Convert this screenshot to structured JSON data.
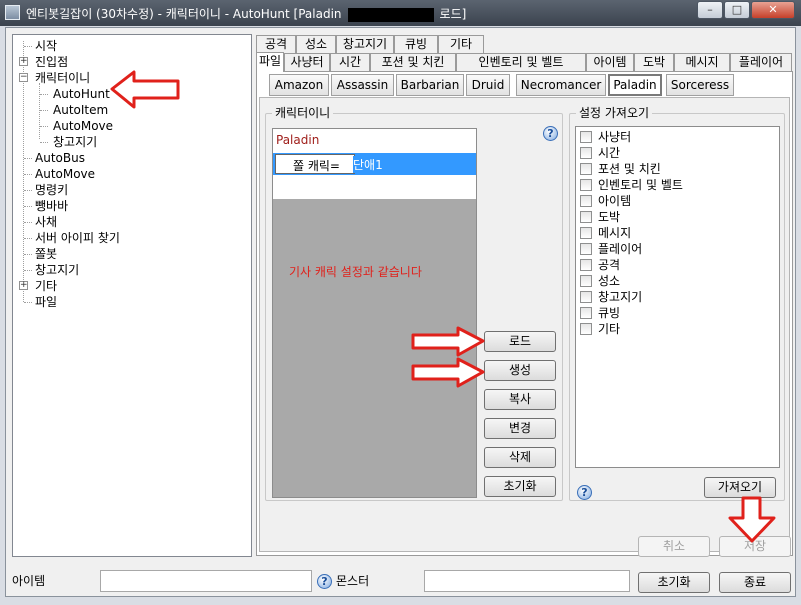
{
  "window": {
    "title_prefix": "엔티봇길잡이 (30차수정) - 캐릭터이니 - AutoHunt [Paladin",
    "title_suffix": "로드]",
    "minimize_glyph": "–",
    "maximize_glyph": "□",
    "close_glyph": "✕"
  },
  "tree": {
    "items": [
      {
        "label": "시작"
      },
      {
        "label": "진입점",
        "expander": "+"
      },
      {
        "label": "캐릭터이니",
        "expander": "−"
      },
      {
        "label": "AutoHunt"
      },
      {
        "label": "AutoItem"
      },
      {
        "label": "AutoMove"
      },
      {
        "label": "창고지기"
      },
      {
        "label": "AutoBus"
      },
      {
        "label": "AutoMove"
      },
      {
        "label": "명령키"
      },
      {
        "label": "뺑바바"
      },
      {
        "label": "사채"
      },
      {
        "label": "서버 아이피 찾기"
      },
      {
        "label": "쫄봇"
      },
      {
        "label": "창고지기"
      },
      {
        "label": "기타",
        "expander": "+"
      },
      {
        "label": "파일"
      }
    ]
  },
  "tabs": {
    "top": [
      "공격",
      "성소",
      "창고지기",
      "큐빙",
      "기타"
    ],
    "bottom": [
      "파일",
      "사냥터",
      "시간",
      "포션 및 치킨",
      "인벤토리 및 벨트",
      "아이템",
      "도박",
      "메시지",
      "플레이어"
    ],
    "active": "파일"
  },
  "subtabs": {
    "items": [
      "Amazon",
      "Assassin",
      "Barbarian",
      "Druid",
      "Necromancer",
      "Paladin",
      "Sorceress"
    ],
    "active": "Paladin"
  },
  "character_group": {
    "title": "캐릭터이니",
    "list_header": "Paladin",
    "selected_item_prefix": "쫄 캐릭=",
    "selected_item_value": "단애1",
    "note": "기사 캐릭 설정과 같습니다",
    "help_glyph": "?"
  },
  "buttons": {
    "load": "로드",
    "create": "생성",
    "copy": "복사",
    "change": "변경",
    "delete": "삭제",
    "reset": "초기화",
    "import": "가져오기",
    "cancel": "취소",
    "save": "저장",
    "bottom_reset": "초기화",
    "exit": "종료"
  },
  "import_group": {
    "title": "설정 가져오기",
    "help_glyph": "?",
    "options": [
      "사냥터",
      "시간",
      "포션 및 치킨",
      "인벤토리 및 벨트",
      "아이템",
      "도박",
      "메시지",
      "플레이어",
      "공격",
      "성소",
      "창고지기",
      "큐빙",
      "기타"
    ]
  },
  "statusbar": {
    "left_label": "아이템",
    "right_label": "몬스터",
    "help_glyph": "?"
  },
  "colors": {
    "annotation_red": "#e0211b",
    "selection_blue": "#3399ff",
    "list_gray": "#a9a9a9",
    "paladin_text": "#a0201c"
  }
}
